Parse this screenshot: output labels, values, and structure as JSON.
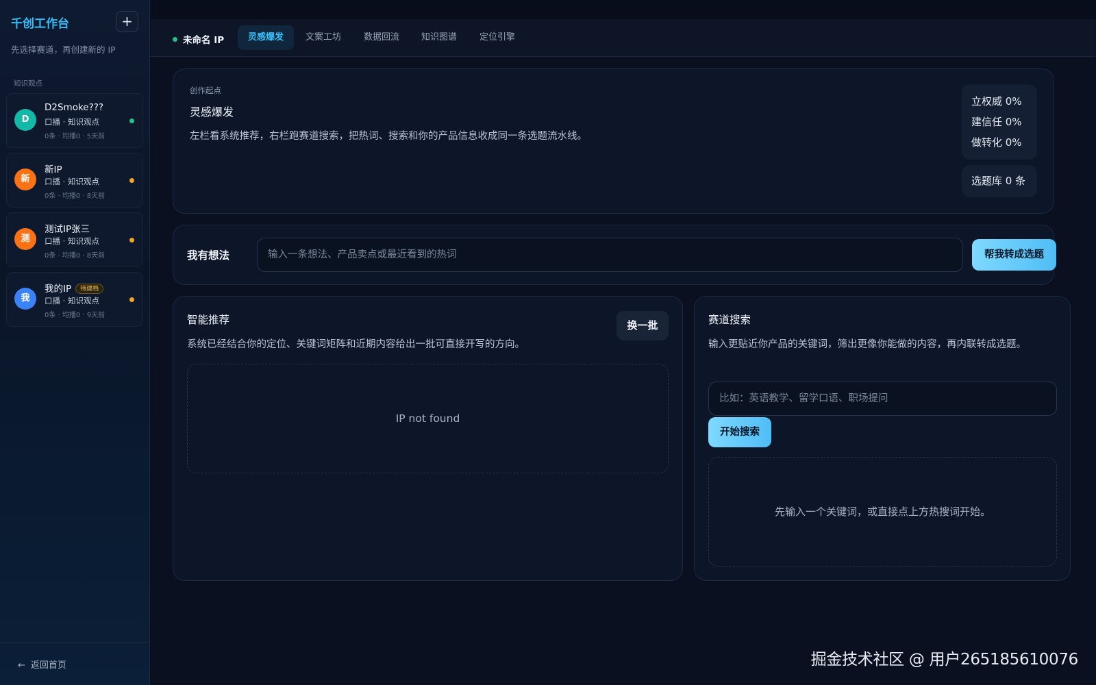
{
  "sidebar": {
    "title": "千创工作台",
    "add_label": "+",
    "subtitle": "先选择赛道，再创建新的 IP",
    "section": "知识观点",
    "items": [
      {
        "avatar": "D",
        "avatar_color": "#14b8a6",
        "name": "D2Smoke???",
        "badge": "",
        "meta": "口播 · 知识观点",
        "stat": "0条 · 均播0 · 5天前",
        "dot_color": "#22c08a"
      },
      {
        "avatar": "新",
        "avatar_color": "#f97316",
        "name": "新IP",
        "badge": "",
        "meta": "口播 · 知识观点",
        "stat": "0条 · 均播0 · 8天前",
        "dot_color": "#f5a524"
      },
      {
        "avatar": "测",
        "avatar_color": "#f97316",
        "name": "测试IP张三",
        "badge": "",
        "meta": "口播 · 知识观点",
        "stat": "0条 · 均播0 · 8天前",
        "dot_color": "#f5a524"
      },
      {
        "avatar": "我",
        "avatar_color": "#3b82f6",
        "name": "我的IP",
        "badge": "待建档",
        "meta": "口播 · 知识观点",
        "stat": "0条 · 均播0 · 9天前",
        "dot_color": "#f5a524"
      }
    ],
    "back_icon": "arrow-left-icon",
    "back_label": "返回首页"
  },
  "header": {
    "ip_name": "未命名 IP",
    "ip_status_color": "#22c08a",
    "tabs": [
      {
        "label": "灵感爆发",
        "active": true
      },
      {
        "label": "文案工坊",
        "active": false
      },
      {
        "label": "数据回流",
        "active": false
      },
      {
        "label": "知识图谱",
        "active": false
      },
      {
        "label": "定位引擎",
        "active": false
      }
    ]
  },
  "overview": {
    "label": "创作起点",
    "title": "灵感爆发",
    "description": "左栏看系统推荐，右栏跑赛道搜索，把热词、搜索和你的产品信息收成同一条选题流水线。",
    "stats": [
      "立权威 0%",
      "建信任 0%",
      "做转化 0%"
    ],
    "topic_count": "选题库 0 条"
  },
  "idea": {
    "label": "我有想法",
    "placeholder": "输入一条想法、产品卖点或最近看到的热词",
    "value": "",
    "button": "帮我转成选题"
  },
  "recommend": {
    "title": "智能推荐",
    "refresh_button": "换一批",
    "description": "系统已经结合你的定位、关键词矩阵和近期内容给出一批可直接开写的方向。",
    "empty": "IP not found"
  },
  "track_search": {
    "title": "赛道搜索",
    "description": "输入更贴近你产品的关键词，筛出更像你能做的内容，再内联转成选题。",
    "placeholder": "比如：英语教学、留学口语、职场提问",
    "value": "",
    "button": "开始搜索",
    "empty": "先输入一个关键词，或直接点上方热搜词开始。"
  },
  "watermark": "掘金技术社区 @ 用户265185610076",
  "colors": {
    "accent": "#38bdf8",
    "background": "#0a1020",
    "panel": "#0d1629"
  }
}
